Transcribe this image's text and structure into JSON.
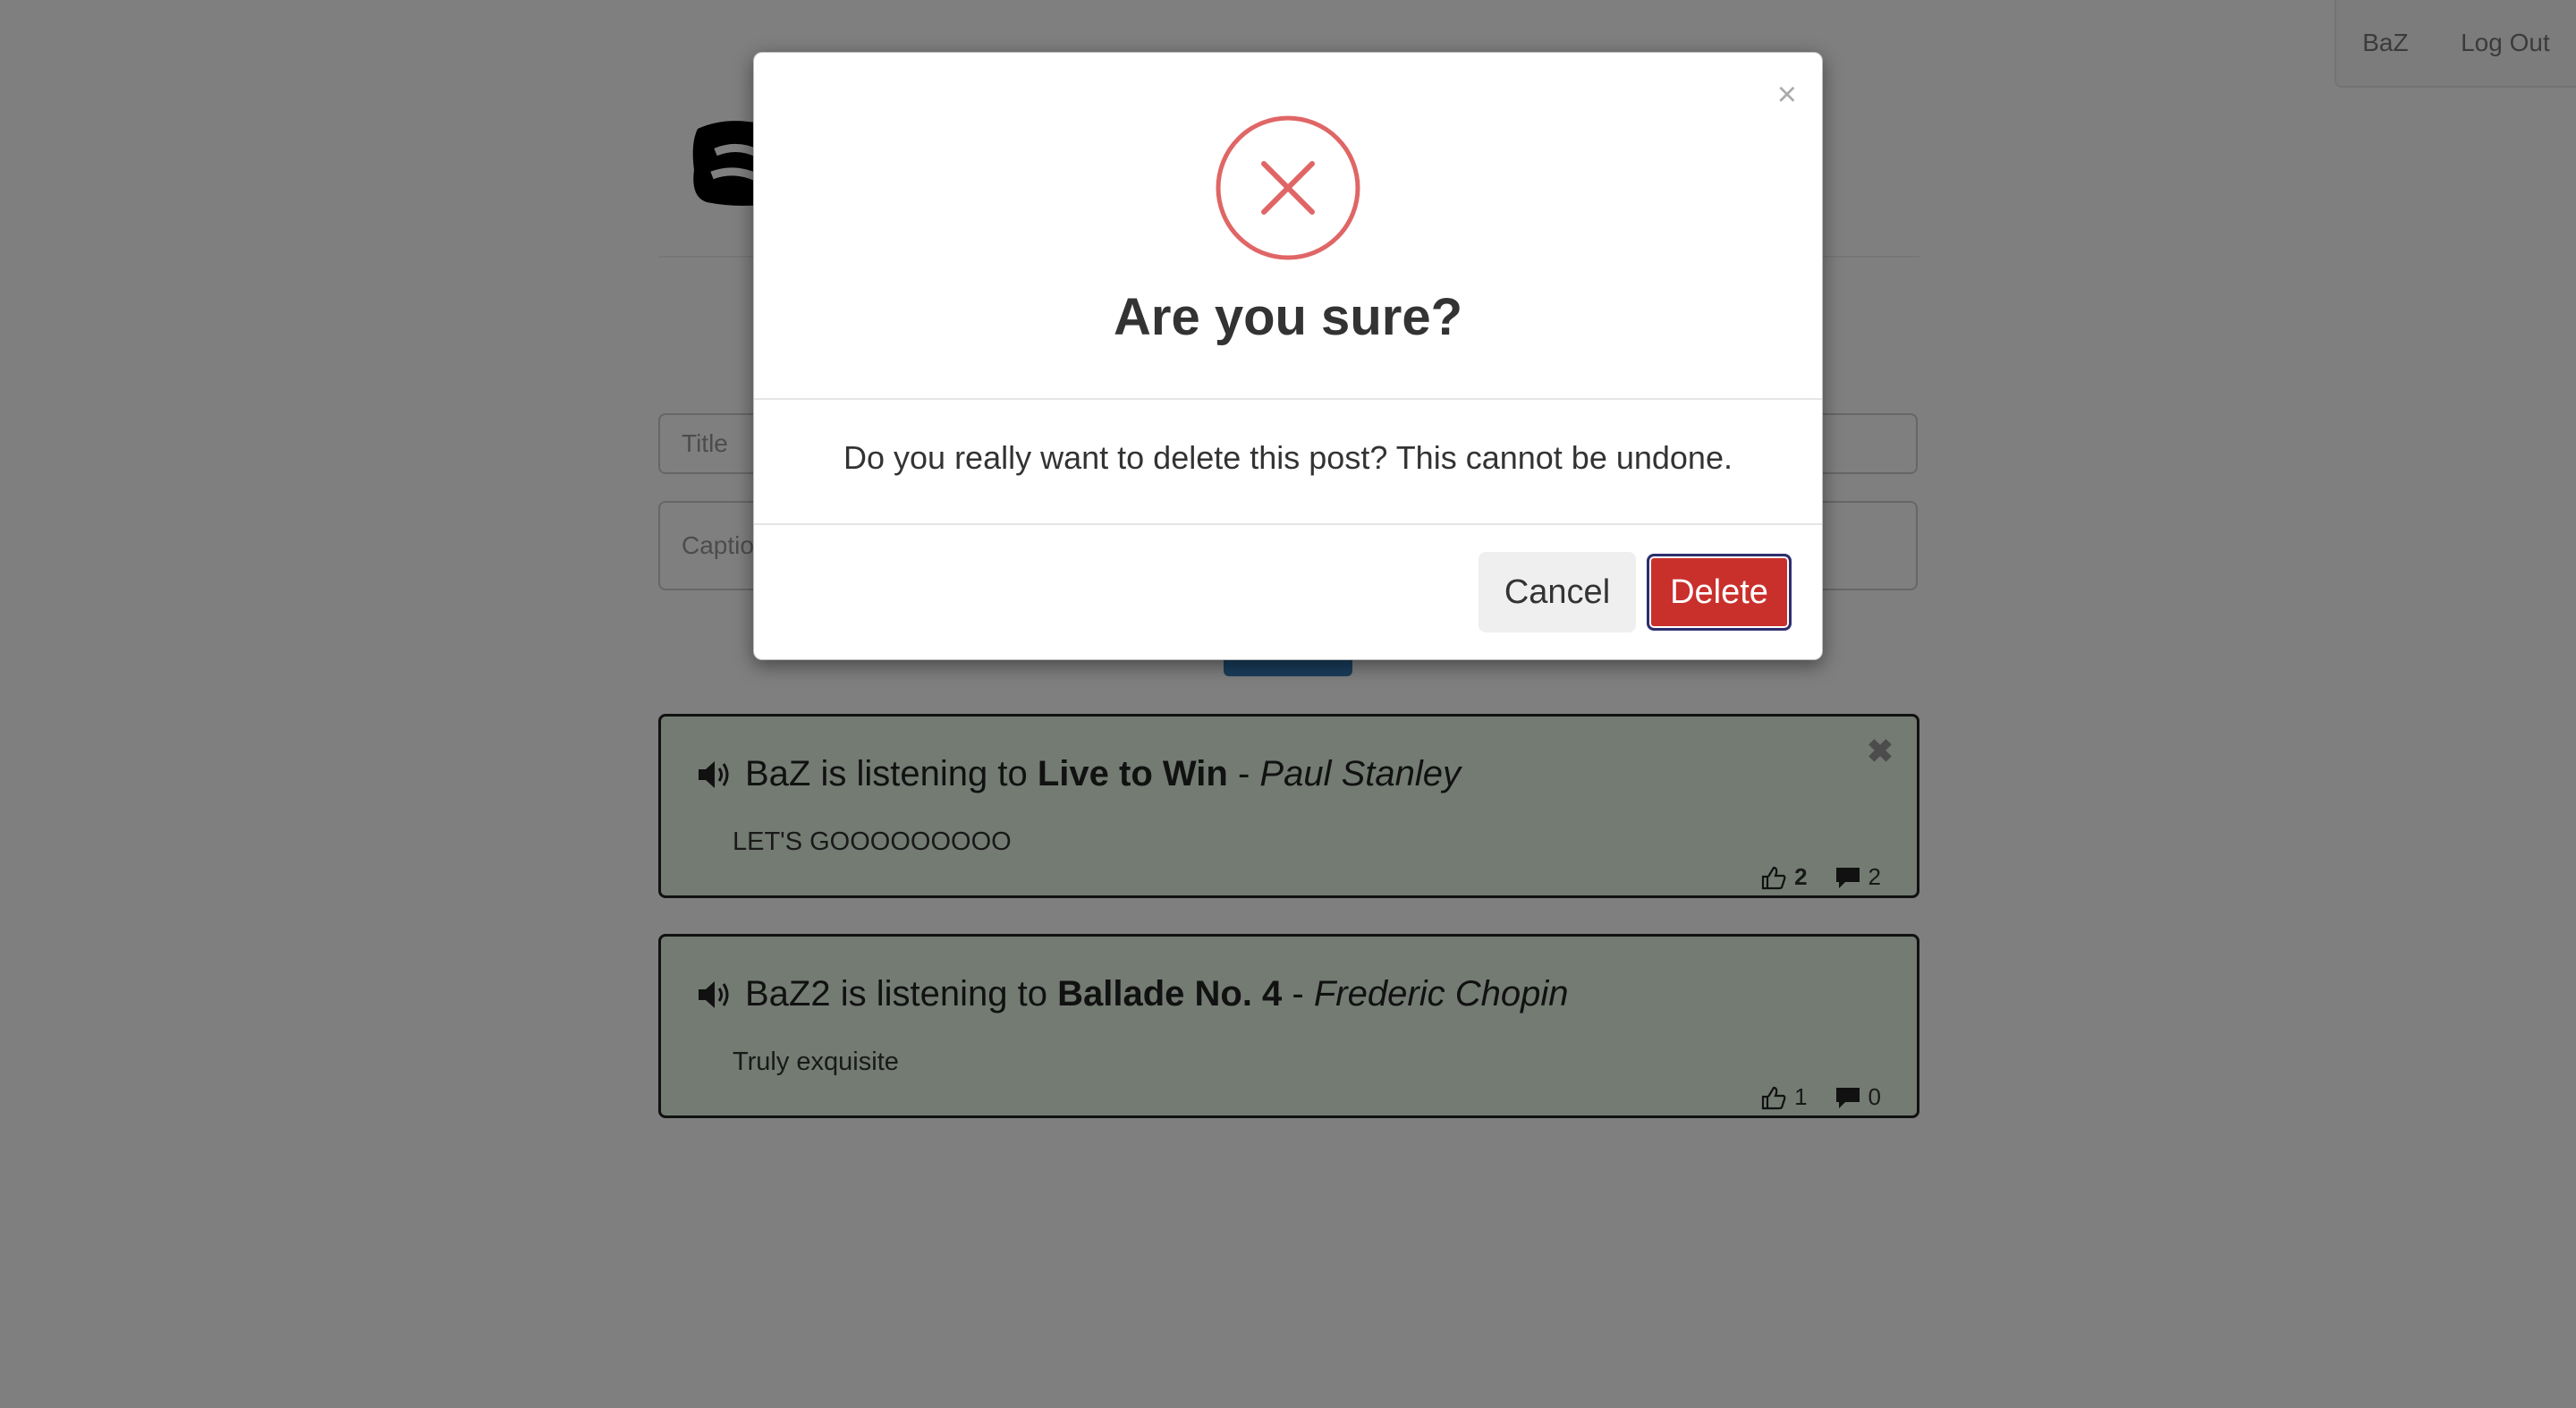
{
  "nav": {
    "user_label": "BaZ",
    "logout_label": "Log Out"
  },
  "form": {
    "title_placeholder": "Title",
    "caption_placeholder": "Caption"
  },
  "posts": [
    {
      "user": "BaZ",
      "verb": "is listening to",
      "song": "Live to Win",
      "sep": "-",
      "artist": "Paul Stanley",
      "caption": "LET'S GOOOOOOOOO",
      "likes": "2",
      "comments": "2",
      "delete_glyph": "✖"
    },
    {
      "user": "BaZ2",
      "verb": "is listening to",
      "song": "Ballade No. 4",
      "sep": "-",
      "artist": "Frederic Chopin",
      "caption": "Truly exquisite",
      "likes": "1",
      "comments": "0"
    }
  ],
  "modal": {
    "close_glyph": "×",
    "icon": "error-circle-x-icon",
    "title": "Are you sure?",
    "message": "Do you really want to delete this post? This cannot be undone.",
    "cancel_label": "Cancel",
    "delete_label": "Delete",
    "accent_color": "#e06666",
    "delete_color": "#c9302c"
  }
}
